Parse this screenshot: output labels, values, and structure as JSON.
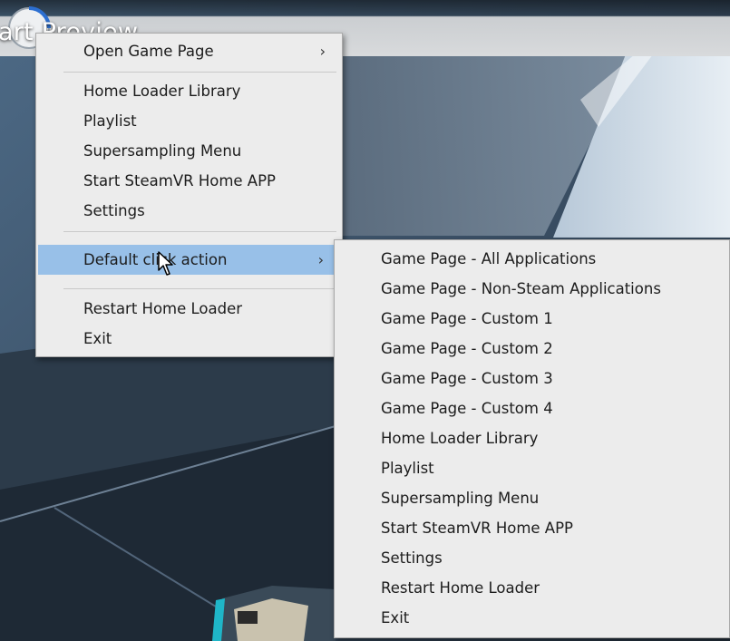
{
  "video_title": "art Preview",
  "main_menu": {
    "items": [
      {
        "label": "Open Game Page",
        "submenu": true
      },
      {
        "label": "Home Loader Library"
      },
      {
        "label": "Playlist"
      },
      {
        "label": "Supersampling Menu"
      },
      {
        "label": "Start SteamVR Home APP"
      },
      {
        "label": "Settings"
      },
      {
        "label": "Default click action",
        "submenu": true,
        "highlighted": true
      },
      {
        "label": "Restart Home Loader"
      },
      {
        "label": "Exit"
      }
    ]
  },
  "submenu": {
    "items": [
      {
        "label": "Game Page - All Applications"
      },
      {
        "label": "Game Page - Non-Steam Applications"
      },
      {
        "label": "Game Page - Custom 1"
      },
      {
        "label": "Game Page - Custom 2"
      },
      {
        "label": "Game Page - Custom 3"
      },
      {
        "label": "Game Page - Custom 4"
      },
      {
        "label": "Home Loader Library"
      },
      {
        "label": "Playlist"
      },
      {
        "label": "Supersampling Menu"
      },
      {
        "label": "Start SteamVR Home APP"
      },
      {
        "label": "Settings"
      },
      {
        "label": "Restart Home Loader"
      },
      {
        "label": "Exit"
      }
    ]
  },
  "icons": {
    "submenu_arrow": "›",
    "logo": "circular-logo-icon",
    "cursor": "mouse-pointer-icon"
  },
  "colors": {
    "menu_bg": "#ececec",
    "highlight": "#98c0e8",
    "text": "#1c1c1c"
  }
}
